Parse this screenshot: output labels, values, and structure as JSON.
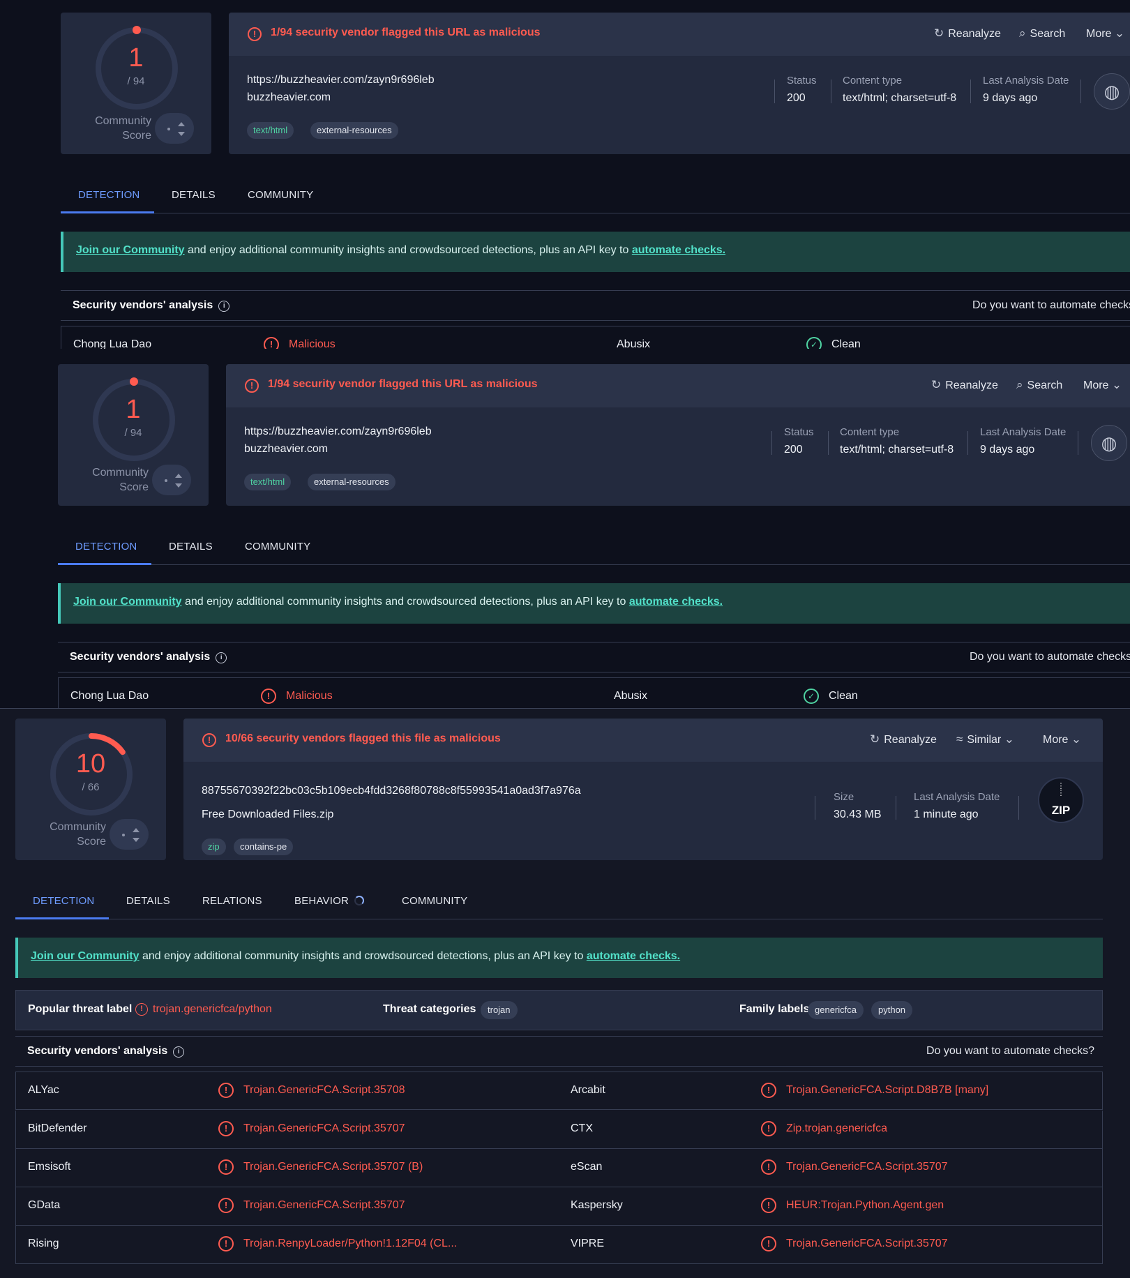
{
  "url_report": {
    "score": "1",
    "score_total": "/ 94",
    "community_label_1": "Community",
    "community_label_2": "Score",
    "alert": "1/94 security vendor flagged this URL as malicious",
    "actions": {
      "reanalyze": "Reanalyze",
      "search": "Search",
      "more": "More"
    },
    "url": "https://buzzheavier.com/zayn9r696leb",
    "domain": "buzzheavier.com",
    "tags": [
      "text/html",
      "external-resources"
    ],
    "meta": {
      "status_label": "Status",
      "status_value": "200",
      "content_type_label": "Content type",
      "content_type_value": "text/html; charset=utf-8",
      "last_analysis_label": "Last Analysis Date",
      "last_analysis_value": "9 days ago"
    },
    "tabs": [
      "DETECTION",
      "DETAILS",
      "COMMUNITY"
    ],
    "banner": {
      "link1": "Join our Community",
      "middle": " and enjoy additional community insights and crowdsourced detections, plus an API key to ",
      "link2": "automate checks."
    },
    "vendors_title": "Security vendors' analysis",
    "automate_prompt": "Do you want to automate checks",
    "row": {
      "v1": "Chong Lua Dao",
      "r1": "Malicious",
      "v2": "Abusix",
      "r2": "Clean"
    }
  },
  "file_report": {
    "score": "10",
    "score_total": "/ 66",
    "score_fraction": 0.1515,
    "community_label_1": "Community",
    "community_label_2": "Score",
    "alert": "10/66 security vendors flagged this file as malicious",
    "actions": {
      "reanalyze": "Reanalyze",
      "similar": "Similar",
      "more": "More"
    },
    "hash": "88755670392f22bc03c5b109ecb4fdd3268f80788c8f55993541a0ad3f7a976a",
    "filename": "Free Downloaded Files.zip",
    "tags": [
      "zip",
      "contains-pe"
    ],
    "meta": {
      "size_label": "Size",
      "size_value": "30.43 MB",
      "last_analysis_label": "Last Analysis Date",
      "last_analysis_value": "1 minute ago"
    },
    "file_icon_text": "ZIP",
    "tabs": [
      "DETECTION",
      "DETAILS",
      "RELATIONS",
      "BEHAVIOR",
      "COMMUNITY"
    ],
    "banner": {
      "link1": "Join our Community",
      "middle": " and enjoy additional community insights and crowdsourced detections, plus an API key to ",
      "link2": "automate checks."
    },
    "threat": {
      "popular_label": "Popular threat label",
      "popular_value": "trojan.genericfca/python",
      "categories_label": "Threat categories",
      "categories": [
        "trojan"
      ],
      "family_label": "Family labels",
      "families": [
        "genericfca",
        "python"
      ]
    },
    "vendors_title": "Security vendors' analysis",
    "automate_prompt": "Do you want to automate checks?",
    "vendors": [
      {
        "v1": "ALYac",
        "r1": "Trojan.GenericFCA.Script.35708",
        "v2": "Arcabit",
        "r2": "Trojan.GenericFCA.Script.D8B7B [many]"
      },
      {
        "v1": "BitDefender",
        "r1": "Trojan.GenericFCA.Script.35707",
        "v2": "CTX",
        "r2": "Zip.trojan.genericfca"
      },
      {
        "v1": "Emsisoft",
        "r1": "Trojan.GenericFCA.Script.35707 (B)",
        "v2": "eScan",
        "r2": "Trojan.GenericFCA.Script.35707"
      },
      {
        "v1": "GData",
        "r1": "Trojan.GenericFCA.Script.35707",
        "v2": "Kaspersky",
        "r2": "HEUR:Trojan.Python.Agent.gen"
      },
      {
        "v1": "Rising",
        "r1": "Trojan.RenpyLoader/Python!1.12F04 (CL...",
        "v2": "VIPRE",
        "r2": "Trojan.GenericFCA.Script.35707"
      }
    ]
  },
  "colors": {
    "malicious": "#ff5b50",
    "accent": "#4b7bf0",
    "banner_bg": "#1c4340",
    "banner_link": "#52e1c9",
    "panel": "#232a3e"
  }
}
